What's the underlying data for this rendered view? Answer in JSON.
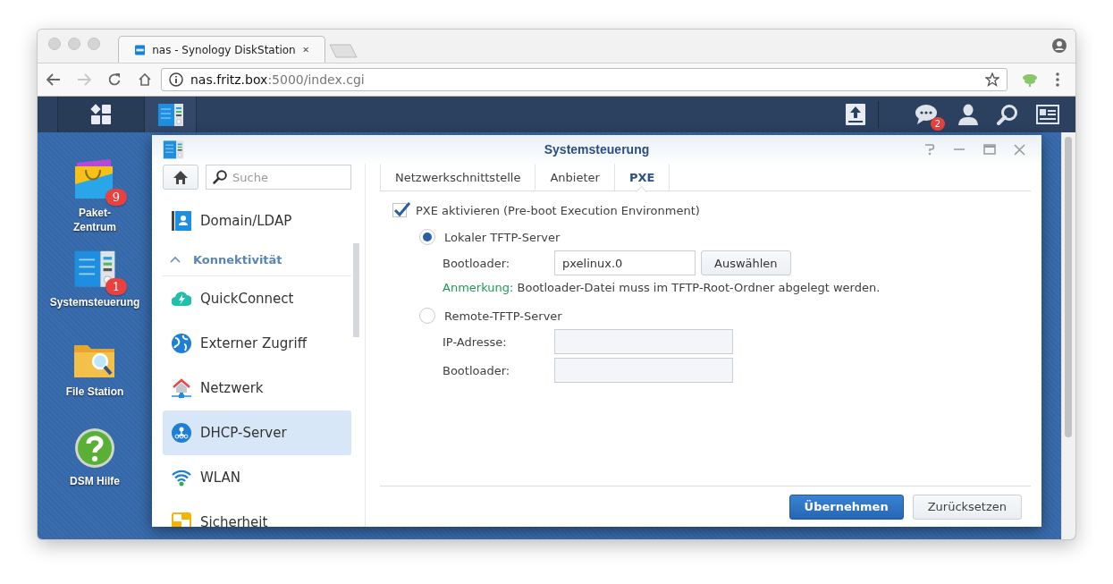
{
  "browser": {
    "tabs": [
      {
        "title": "nas - Synology DiskStation",
        "selected": true
      }
    ],
    "address": {
      "host": "nas.fritz.box",
      "rest": ":5000/index.cgi"
    }
  },
  "taskbar": {
    "notifications": "2"
  },
  "desktop": {
    "icons": [
      {
        "label": "Paket-Zentrum",
        "badge": "9"
      },
      {
        "label": "Systemsteuerung",
        "badge": "1"
      },
      {
        "label": "File Station"
      },
      {
        "label": "DSM Hilfe"
      }
    ]
  },
  "window": {
    "title": "Systemsteuerung",
    "search": {
      "placeholder": "Suche"
    },
    "sidebar": {
      "items": [
        {
          "kind": "item",
          "label": "Domain/LDAP",
          "selected": false
        },
        {
          "kind": "header",
          "label": "Konnektivität",
          "expanded": true
        },
        {
          "kind": "item",
          "label": "QuickConnect",
          "selected": false
        },
        {
          "kind": "item",
          "label": "Externer Zugriff",
          "selected": false
        },
        {
          "kind": "item",
          "label": "Netzwerk",
          "selected": false
        },
        {
          "kind": "item",
          "label": "DHCP-Server",
          "selected": true
        },
        {
          "kind": "item",
          "label": "WLAN",
          "selected": false
        },
        {
          "kind": "item",
          "label": "Sicherheit",
          "selected": false
        }
      ]
    },
    "tabs": [
      {
        "label": "Netzwerkschnittstelle",
        "selected": false
      },
      {
        "label": "Anbieter",
        "selected": false
      },
      {
        "label": "PXE",
        "selected": true
      }
    ],
    "pxe": {
      "label": "PXE aktivieren (Pre-boot Execution Environment)",
      "checked": true,
      "modes": [
        {
          "label": "Lokaler TFTP-Server",
          "selected": true,
          "fields": [
            {
              "label": "Bootloader:",
              "value": "pxelinux.0",
              "button": "Auswählen",
              "disabled": false
            }
          ],
          "note": {
            "prefix": "Anmerkung:",
            "text": "Bootloader-Datei muss im TFTP-Root-Ordner abgelegt werden."
          }
        },
        {
          "label": "Remote-TFTP-Server",
          "selected": false,
          "fields": [
            {
              "label": "IP-Adresse:",
              "disabled": true
            },
            {
              "label": "Bootloader:",
              "disabled": true
            }
          ]
        }
      ]
    },
    "buttons": [
      {
        "label": "Übernehmen",
        "kind": "primary"
      },
      {
        "label": "Zurücksetzen",
        "kind": "secondary"
      }
    ]
  }
}
